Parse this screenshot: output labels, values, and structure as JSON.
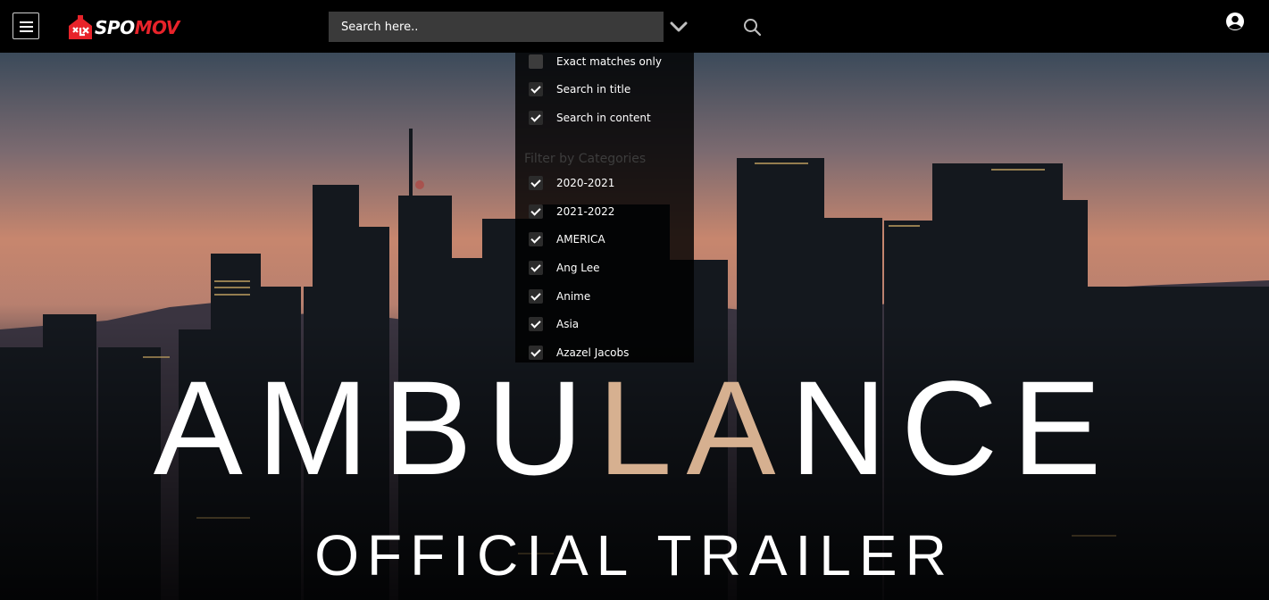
{
  "header": {
    "logo": {
      "text_white": "SPO",
      "text_red": "MOV"
    },
    "search": {
      "placeholder": "Search here.."
    },
    "icons": {
      "menu": "hamburger-menu-icon",
      "dropdown": "chevron-down-icon",
      "search": "search-icon",
      "user": "user-icon"
    }
  },
  "search_options": {
    "toggles": [
      {
        "label": "Exact matches only",
        "checked": false
      },
      {
        "label": "Search in title",
        "checked": true
      },
      {
        "label": "Search in content",
        "checked": true
      }
    ],
    "categories_title": "Filter by Categories",
    "categories": [
      {
        "label": "2020-2021",
        "checked": true
      },
      {
        "label": "2021-2022",
        "checked": true
      },
      {
        "label": "AMERICA",
        "checked": true
      },
      {
        "label": "Ang Lee",
        "checked": true
      },
      {
        "label": "Anime",
        "checked": true
      },
      {
        "label": "Asia",
        "checked": true
      },
      {
        "label": "Azazel Jacobs",
        "checked": true
      }
    ]
  },
  "hero": {
    "title_part1": "AMBU",
    "title_accent": "LA",
    "title_part2": "NCE",
    "subtitle": "OFFICIAL TRAILER"
  },
  "colors": {
    "brand_red": "#e8232a",
    "title_accent": "#d6b090",
    "header_bg": "#000000",
    "search_bg": "#3a3a3a"
  }
}
